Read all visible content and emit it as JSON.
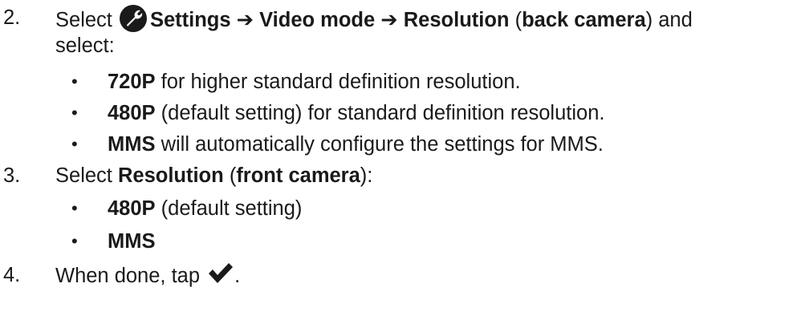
{
  "step2": {
    "number": "2.",
    "select_word": "Select",
    "icon": "wrench-settings-icon",
    "settings": "Settings",
    "arrow1": "➔",
    "video_mode": "Video mode",
    "arrow2": "➔",
    "resolution": "Resolution",
    "back_camera": "back camera",
    "open_paren": "(",
    "close_paren": ")",
    "and": "and",
    "select_colon": "select:",
    "options": [
      {
        "bold": "720P",
        "text": " for higher standard definition resolution."
      },
      {
        "bold": "480P",
        "text": " (default setting) for standard definition resolution."
      },
      {
        "bold": "MMS",
        "text": " will automatically configure the settings for MMS."
      }
    ]
  },
  "step3": {
    "number": "3.",
    "select_word": "Select",
    "resolution": "Resolution",
    "open_paren": "(",
    "front_camera": "front camera",
    "close_paren": ")",
    "colon": ":",
    "options": [
      {
        "bold": "480P",
        "text": " (default setting)"
      },
      {
        "bold": "MMS",
        "text": ""
      }
    ]
  },
  "step4": {
    "number": "4.",
    "text": "When done, tap",
    "icon": "checkmark-icon",
    "period": "."
  },
  "bullet_char": "•"
}
